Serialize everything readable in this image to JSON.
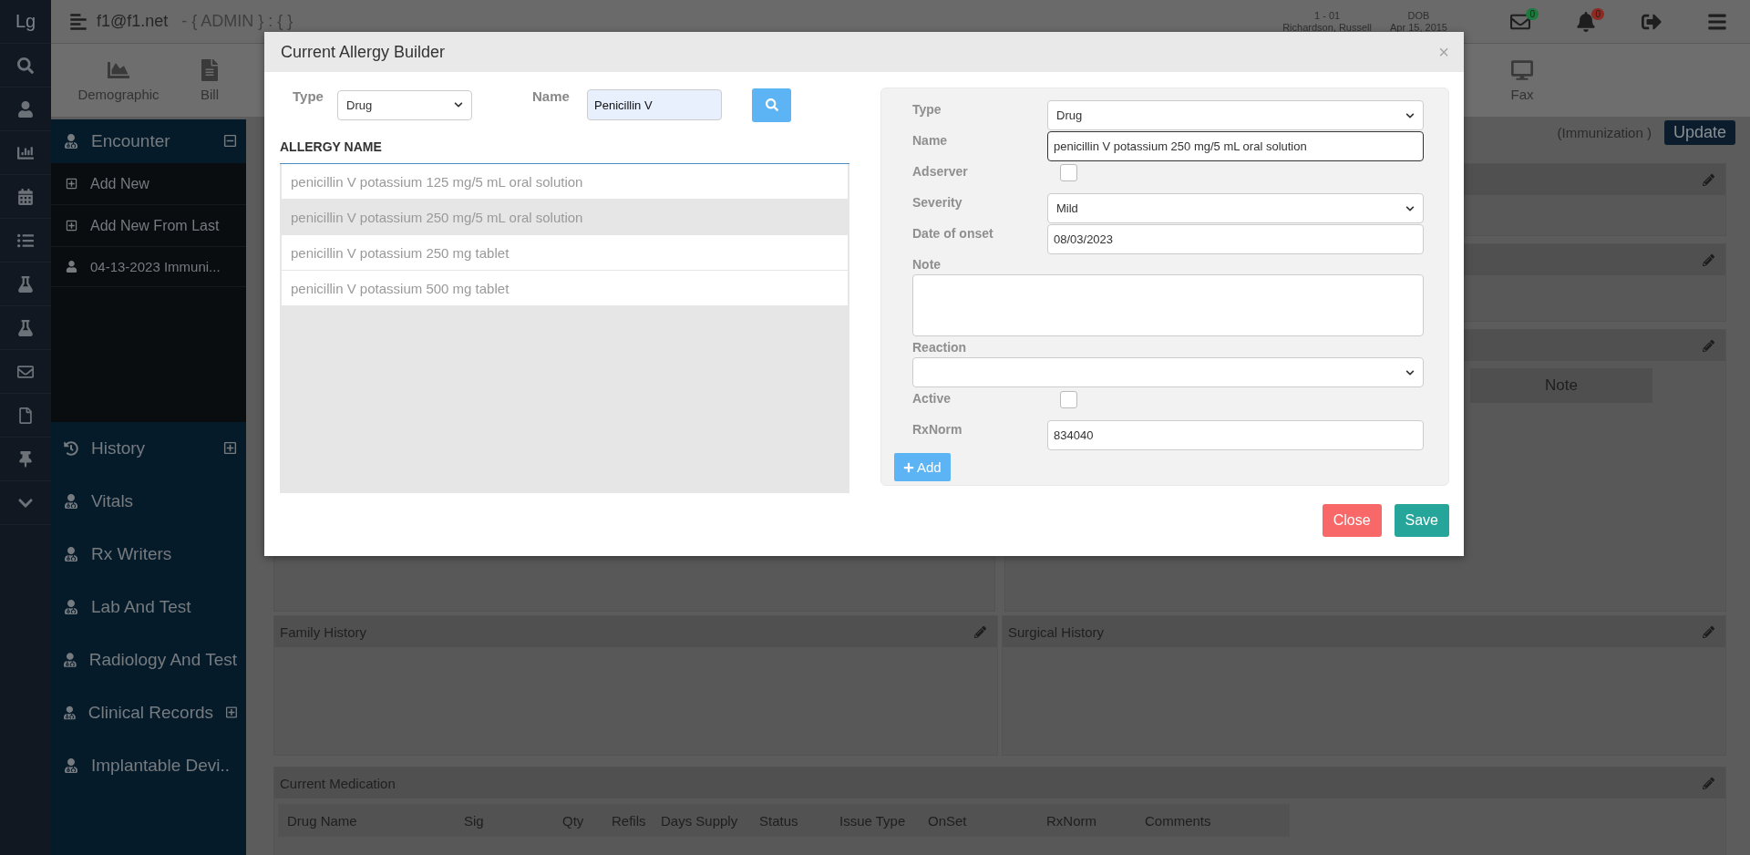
{
  "header": {
    "user": "f1@f1.net",
    "role": " - { ADMIN } : { }",
    "patient_id": "1 - 01",
    "patient_name": "Richardson, Russell",
    "dob_label": "DOB",
    "dob": "Apr 15, 2015",
    "messages_count": "0",
    "alerts_count": "0"
  },
  "rail": {
    "logo": "Lg"
  },
  "toolbar": {
    "left": [
      {
        "label": "Demographic",
        "kind": "chart"
      },
      {
        "label": "Bill",
        "kind": "file"
      }
    ],
    "right": [
      {
        "label": "Fax",
        "kind": "monitor"
      }
    ]
  },
  "sidebar": {
    "items": [
      {
        "label": "Encounter",
        "kind": "group",
        "expanded": true,
        "children": [
          {
            "label": "Add New",
            "kind": "add"
          },
          {
            "label": "Add New From Last",
            "kind": "add"
          },
          {
            "label": "04-13-2023 Immuni...",
            "kind": "visit"
          }
        ]
      },
      {
        "label": "History",
        "kind": "history",
        "expanded": false
      },
      {
        "label": "Vitals",
        "kind": "link"
      },
      {
        "label": "Rx Writers",
        "kind": "link"
      },
      {
        "label": "Lab And Test",
        "kind": "link"
      },
      {
        "label": "Radiology And Test",
        "kind": "link"
      },
      {
        "label": "Clinical Records",
        "kind": "group",
        "expanded": false
      },
      {
        "label": "Implantable Devi..",
        "kind": "link"
      }
    ]
  },
  "content": {
    "encounter_type": "(Immunization )",
    "update_button": "Update",
    "note_column": "Note",
    "family_history": "Family History",
    "surgical_history": "Surgical History",
    "current_medication": "Current Medication",
    "medication_columns": [
      "Drug Name",
      "Sig",
      "Qty",
      "Refils",
      "Days Supply",
      "Status",
      "Issue Type",
      "OnSet",
      "RxNorm",
      "Comments"
    ]
  },
  "modal": {
    "title": "Current Allergy Builder",
    "close_icon": "×",
    "search": {
      "type_label": "Type",
      "type_value": "Drug",
      "name_label": "Name",
      "name_value": "Penicillin V"
    },
    "list_heading": "ALLERGY NAME",
    "results": [
      {
        "name": "penicillin V potassium 125 mg/5 mL oral solution",
        "selected": false
      },
      {
        "name": "penicillin V potassium 250 mg/5 mL oral solution",
        "selected": true
      },
      {
        "name": "penicillin V potassium 250 mg tablet",
        "selected": false
      },
      {
        "name": "penicillin V potassium 500 mg tablet",
        "selected": false
      }
    ],
    "form": [
      {
        "label": "Type",
        "kind": "select",
        "value": "Drug",
        "label_above": false,
        "focused": false
      },
      {
        "label": "Name",
        "kind": "text",
        "value": "penicillin V potassium 250 mg/5 mL oral solution",
        "label_above": false,
        "focused": true
      },
      {
        "label": "Adserver",
        "kind": "checkbox",
        "checked": false,
        "label_above": false
      },
      {
        "label": "Severity",
        "kind": "select",
        "value": "Mild",
        "label_above": false,
        "focused": false
      },
      {
        "label": "Date of onset",
        "kind": "text",
        "value": "08/03/2023",
        "label_above": false,
        "focused": false
      },
      {
        "label": "Note",
        "kind": "textarea",
        "label_above": true,
        "focused": false
      },
      {
        "label": "Reaction",
        "kind": "select",
        "label_above": true,
        "focused": false
      },
      {
        "label": "Active",
        "kind": "checkbox",
        "checked": false,
        "label_above": false
      },
      {
        "label": "RxNorm",
        "kind": "text",
        "value": "834040",
        "label_above": false,
        "focused": false
      }
    ],
    "add_button": "Add",
    "close_button": "Close",
    "save_button": "Save"
  }
}
